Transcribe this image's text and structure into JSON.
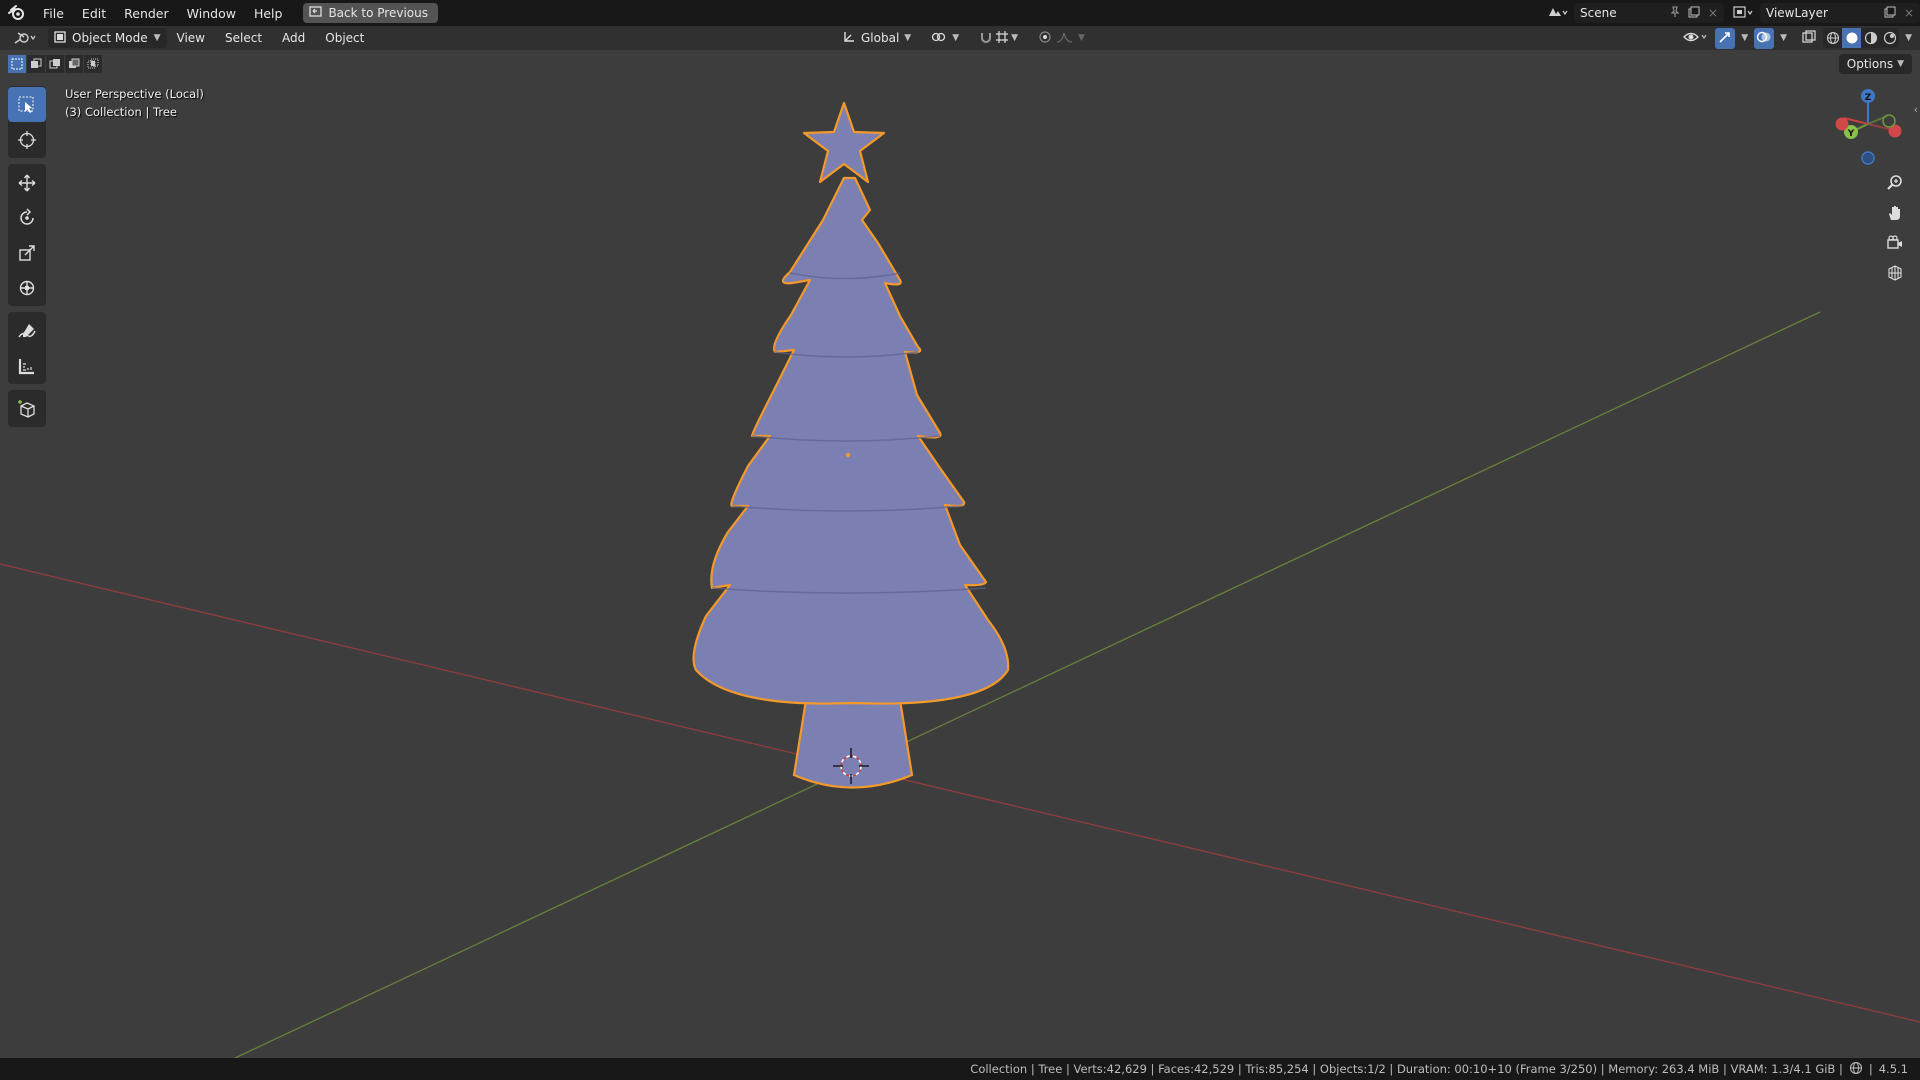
{
  "menubar": {
    "items": [
      "File",
      "Edit",
      "Render",
      "Window",
      "Help"
    ],
    "back_button": "Back to Previous"
  },
  "scene": {
    "label": "Scene"
  },
  "viewlayer": {
    "label": "ViewLayer"
  },
  "viewport_header": {
    "mode": "Object Mode",
    "menus": [
      "View",
      "Select",
      "Add",
      "Object"
    ],
    "orientation": "Global"
  },
  "options_label": "Options",
  "overlay": {
    "perspective": "User Perspective (Local)",
    "collection": "(3) Collection | Tree"
  },
  "gizmo": {
    "z": "Z",
    "y": "Y"
  },
  "status": {
    "text": "Collection | Tree | Verts:42,629 | Faces:42,529 | Tris:85,254 | Objects:1/2 | Duration: 00:10+10 (Frame 3/250) | Memory: 263.4 MiB | VRAM: 1.3/4.1 GiB |",
    "version": "4.5.1"
  },
  "colors": {
    "tree_fill": "#7c7fb2",
    "selection_outline": "#f39a2a",
    "x_axis": "#a03c3c",
    "y_axis": "#6e8f3a",
    "active_tool": "#4772b3"
  },
  "icons": {
    "toolbar": [
      "select-box-icon",
      "cursor-icon",
      "move-icon",
      "rotate-icon",
      "scale-icon",
      "transform-icon",
      "annotate-icon",
      "measure-icon",
      "add-cube-icon"
    ],
    "nav": [
      "zoom-icon",
      "pan-hand-icon",
      "camera-icon",
      "grid-icon"
    ]
  }
}
